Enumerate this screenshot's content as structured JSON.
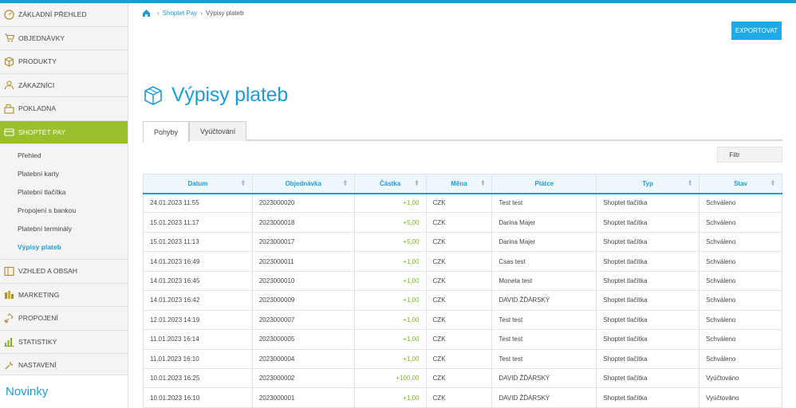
{
  "sidebar": {
    "items_top": [
      {
        "label": "ZÁKLADNÍ PŘEHLED",
        "icon": "speedometer-icon"
      },
      {
        "label": "OBJEDNÁVKY",
        "icon": "cart-icon"
      },
      {
        "label": "PRODUKTY",
        "icon": "box-icon"
      },
      {
        "label": "ZÁKAZNÍCI",
        "icon": "user-icon"
      },
      {
        "label": "POKLADNA",
        "icon": "register-icon"
      },
      {
        "label": "SHOPTET PAY",
        "icon": "wallet-icon"
      }
    ],
    "sub_items": [
      {
        "label": "Přehled"
      },
      {
        "label": "Platební karty"
      },
      {
        "label": "Platební tlačítka"
      },
      {
        "label": "Propojení s bankou"
      },
      {
        "label": "Platební terminály"
      },
      {
        "label": "Výpisy plateb"
      }
    ],
    "items_bottom": [
      {
        "label": "VZHLED A OBSAH",
        "icon": "layout-icon"
      },
      {
        "label": "MARKETING",
        "icon": "marketing-icon"
      },
      {
        "label": "PROPOJENÍ",
        "icon": "link-icon"
      },
      {
        "label": "STATISTIKY",
        "icon": "chart-icon"
      },
      {
        "label": "NASTAVENÍ",
        "icon": "wrench-icon"
      }
    ],
    "novinky": "Novinky"
  },
  "breadcrumb": {
    "link": "Shoptet Pay",
    "current": "Výpisy plateb"
  },
  "toolbar": {
    "export_label": "EXPORTOVAT"
  },
  "page": {
    "title": "Výpisy plateb"
  },
  "tabs": [
    {
      "label": "Pohyby"
    },
    {
      "label": "Vyúčtování"
    }
  ],
  "filter": {
    "label": "Filtr"
  },
  "table": {
    "headers": [
      "Datum",
      "Objednávka",
      "Částka",
      "Měna",
      "Plátce",
      "Typ",
      "Stav"
    ],
    "rows": [
      [
        "24.01.2023 11:55",
        "2023000020",
        "+1,00",
        "CZK",
        "Test test",
        "Shoptet tlačítka",
        "Schváleno"
      ],
      [
        "15.01.2023 11:17",
        "2023000018",
        "+5,00",
        "CZK",
        "Darina Majer",
        "Shoptet tlačítka",
        "Schváleno"
      ],
      [
        "15.01.2023 11:13",
        "2023000017",
        "+5,00",
        "CZK",
        "Darina Majer",
        "Shoptet tlačítka",
        "Schváleno"
      ],
      [
        "14.01.2023 16:49",
        "2023000011",
        "+1,00",
        "CZK",
        "Csas test",
        "Shoptet tlačítka",
        "Schváleno"
      ],
      [
        "14.01.2023 16:45",
        "2023000010",
        "+1,00",
        "CZK",
        "Moneta test",
        "Shoptet tlačítka",
        "Schváleno"
      ],
      [
        "14.01.2023 16:42",
        "2023000009",
        "+1,00",
        "CZK",
        "DAVID ŽĎÁRSKÝ",
        "Shoptet tlačítka",
        "Schváleno"
      ],
      [
        "12.01.2023 14:19",
        "2023000007",
        "+1,00",
        "CZK",
        "Test test",
        "Shoptet tlačítka",
        "Schváleno"
      ],
      [
        "11.01.2023 16:14",
        "2023000005",
        "+1,00",
        "CZK",
        "Test test",
        "Shoptet tlačítka",
        "Schváleno"
      ],
      [
        "11.01.2023 16:10",
        "2023000004",
        "+1,00",
        "CZK",
        "Test test",
        "Shoptet tlačítka",
        "Schváleno"
      ],
      [
        "10.01.2023 16:25",
        "2023000002",
        "+100,00",
        "CZK",
        "DAVID ŽĎÁRSKÝ",
        "Shoptet tlačítka",
        "Vyúčtováno"
      ],
      [
        "10.01.2023 16:10",
        "2023000001",
        "+1,00",
        "CZK",
        "DAVID ŽĎÁRSKÝ",
        "Shoptet tlačítka",
        "Vyúčtováno"
      ]
    ]
  },
  "colors": {
    "accent": "#1e9bd7",
    "active_nav": "#9cbf2c",
    "amount": "#7ab51d"
  }
}
